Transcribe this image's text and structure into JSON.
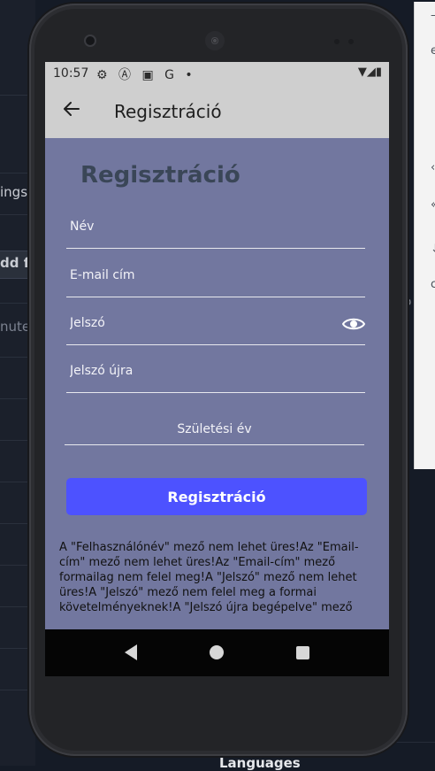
{
  "background_ide": {
    "left_texts": [
      "ings",
      "dd f",
      "nute"
    ],
    "bottom_label": "Languages",
    "right_glyphs": [
      "–",
      "e",
      "‹",
      "«",
      "↓",
      "c",
      "p"
    ]
  },
  "status_bar": {
    "time": "10:57",
    "left_icons": [
      "settings-icon",
      "a-icon",
      "mail-icon",
      "g-icon",
      "dot-icon"
    ],
    "left_icon_glyphs": "⚙ Ⓐ ▣ G •",
    "right_icons": "▼◢▮"
  },
  "app_bar": {
    "title": "Regisztráció"
  },
  "form": {
    "heading": "Regisztráció",
    "name_placeholder": "Név",
    "email_placeholder": "E-mail cím",
    "password_placeholder": "Jelszó",
    "password_again_placeholder": "Jelszó újra",
    "birth_year_label": "Születési év",
    "submit_label": "Regisztráció"
  },
  "errors": {
    "text": "A \"Felhasználónév\" mező nem lehet üres!Az \"Email-cím\" mező nem lehet üres!Az \"Email-cím\" mező formailag nem felel meg!A \"Jelszó\" mező nem lehet üres!A \"Jelszó\" mező nem felel meg a formai követelményeknek!A \"Jelszó újra begépelve\" mező"
  },
  "colors": {
    "screen_bg": "#72779f",
    "app_bar_bg": "#cfcfcf",
    "button_bg": "#4d52ff",
    "heading": "#3a4657"
  }
}
